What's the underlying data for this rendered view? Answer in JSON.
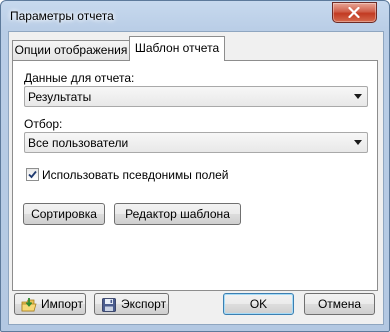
{
  "window": {
    "title": "Параметры отчета"
  },
  "tabs": [
    {
      "label": "Опции отображения",
      "active": false
    },
    {
      "label": "Шаблон отчета",
      "active": true
    }
  ],
  "panel": {
    "data_label": "Данные для отчета:",
    "data_value": "Результаты",
    "filter_label": "Отбор:",
    "filter_value": "Все пользователи",
    "alias_checkbox": {
      "label": "Использовать псевдонимы полей",
      "checked": true
    },
    "sort_button": "Сортировка",
    "template_editor_button": "Редактор шаблона"
  },
  "footer": {
    "import_button": "Импорт",
    "export_button": "Экспорт",
    "ok_button": "OK",
    "cancel_button": "Отмена"
  }
}
